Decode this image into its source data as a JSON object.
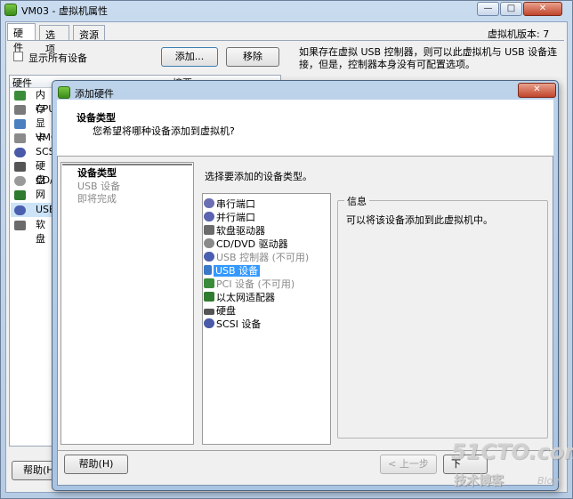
{
  "vm_window": {
    "title": "VM03 - 虚拟机属性",
    "min_glyph": "—",
    "max_glyph": "□",
    "close_glyph": "✕",
    "tabs": [
      {
        "label": "硬件"
      },
      {
        "label": "选项"
      },
      {
        "label": "资源"
      }
    ],
    "vm_version": "虚拟机版本: 7",
    "show_all_devices": "显示所有设备",
    "add_button": "添加...",
    "remove_button": "移除",
    "notice": "如果存在虚拟 USB 控制器，则可以此虚拟机与 USB 设备连接，但是，控制器本身没有可配置选项。",
    "list_headers": {
      "hardware": "硬件",
      "summary": "摘要"
    },
    "hardware_items": [
      {
        "label": "内存",
        "icon": "memory-icon"
      },
      {
        "label": "CPU",
        "icon": "cpu-icon"
      },
      {
        "label": "显卡",
        "icon": "video-card-icon"
      },
      {
        "label": "VMC",
        "icon": "vmci-icon"
      },
      {
        "label": "SCS",
        "icon": "scsi-icon"
      },
      {
        "label": "硬盘",
        "icon": "hard-disk-icon"
      },
      {
        "label": "CD/",
        "icon": "cd-dvd-icon"
      },
      {
        "label": "网络",
        "icon": "network-icon"
      },
      {
        "label": "USB",
        "icon": "usb-icon"
      },
      {
        "label": "软盘",
        "icon": "floppy-icon"
      }
    ],
    "help_button": "帮助(H"
  },
  "dialog": {
    "title": "添加硬件",
    "close_glyph": "✕",
    "header_title": "设备类型",
    "header_subtitle": "您希望将哪种设备添加到虚拟机?",
    "steps": [
      {
        "label": "设备类型",
        "state": "current"
      },
      {
        "label": "USB 设备",
        "state": "pending"
      },
      {
        "label": "即将完成",
        "state": "pending"
      }
    ],
    "prompt": "选择要添加的设备类型。",
    "device_types": [
      {
        "label": "串行端口",
        "icon": "serial-port-icon",
        "color": "#6a6fb4",
        "disabled": false,
        "selected": false
      },
      {
        "label": "并行端口",
        "icon": "parallel-port-icon",
        "color": "#5a64b0",
        "disabled": false,
        "selected": false
      },
      {
        "label": "软盘驱动器",
        "icon": "floppy-drive-icon",
        "color": "#6b6b6b",
        "disabled": false,
        "selected": false
      },
      {
        "label": "CD/DVD 驱动器",
        "icon": "cd-dvd-drive-icon",
        "color": "#8a8a8a",
        "disabled": false,
        "selected": false
      },
      {
        "label": "USB 控制器 (不可用)",
        "icon": "usb-controller-icon",
        "color": "#4b5fb0",
        "disabled": true,
        "selected": false
      },
      {
        "label": "USB 设备",
        "icon": "usb-device-icon",
        "color": "#3a78c8",
        "disabled": false,
        "selected": true
      },
      {
        "label": "PCI 设备 (不可用)",
        "icon": "pci-device-icon",
        "color": "#3a8c3a",
        "disabled": true,
        "selected": false
      },
      {
        "label": "以太网适配器",
        "icon": "ethernet-adapter-icon",
        "color": "#2f7b2f",
        "disabled": false,
        "selected": false
      },
      {
        "label": "硬盘",
        "icon": "hard-disk-icon",
        "color": "#555555",
        "disabled": false,
        "selected": false
      },
      {
        "label": "SCSI 设备",
        "icon": "scsi-device-icon",
        "color": "#4a5aa8",
        "disabled": false,
        "selected": false
      }
    ],
    "info_legend": "信息",
    "info_text": "可以将该设备添加到此虚拟机中。",
    "help_button": "帮助(H)",
    "back_button": "< 上一步",
    "next_button": "下"
  },
  "watermark": {
    "site": "51CTO.com",
    "tagline": "技术博客",
    "blog": "Blog"
  }
}
